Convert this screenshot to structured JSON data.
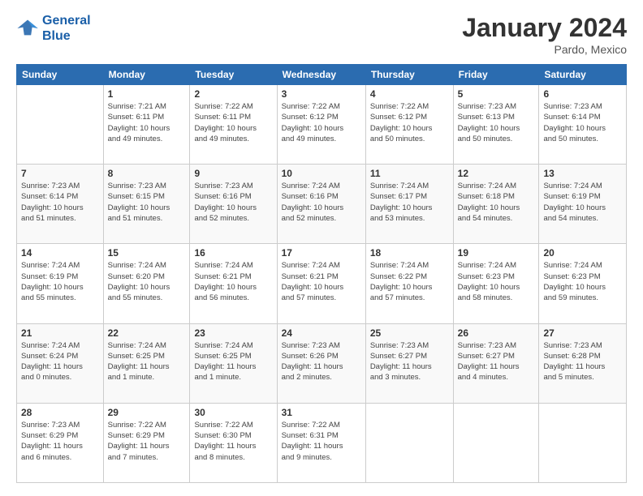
{
  "logo": {
    "line1": "General",
    "line2": "Blue"
  },
  "title": "January 2024",
  "location": "Pardo, Mexico",
  "days_of_week": [
    "Sunday",
    "Monday",
    "Tuesday",
    "Wednesday",
    "Thursday",
    "Friday",
    "Saturday"
  ],
  "weeks": [
    [
      {
        "day": "",
        "info": ""
      },
      {
        "day": "1",
        "info": "Sunrise: 7:21 AM\nSunset: 6:11 PM\nDaylight: 10 hours\nand 49 minutes."
      },
      {
        "day": "2",
        "info": "Sunrise: 7:22 AM\nSunset: 6:11 PM\nDaylight: 10 hours\nand 49 minutes."
      },
      {
        "day": "3",
        "info": "Sunrise: 7:22 AM\nSunset: 6:12 PM\nDaylight: 10 hours\nand 49 minutes."
      },
      {
        "day": "4",
        "info": "Sunrise: 7:22 AM\nSunset: 6:12 PM\nDaylight: 10 hours\nand 50 minutes."
      },
      {
        "day": "5",
        "info": "Sunrise: 7:23 AM\nSunset: 6:13 PM\nDaylight: 10 hours\nand 50 minutes."
      },
      {
        "day": "6",
        "info": "Sunrise: 7:23 AM\nSunset: 6:14 PM\nDaylight: 10 hours\nand 50 minutes."
      }
    ],
    [
      {
        "day": "7",
        "info": "Sunrise: 7:23 AM\nSunset: 6:14 PM\nDaylight: 10 hours\nand 51 minutes."
      },
      {
        "day": "8",
        "info": "Sunrise: 7:23 AM\nSunset: 6:15 PM\nDaylight: 10 hours\nand 51 minutes."
      },
      {
        "day": "9",
        "info": "Sunrise: 7:23 AM\nSunset: 6:16 PM\nDaylight: 10 hours\nand 52 minutes."
      },
      {
        "day": "10",
        "info": "Sunrise: 7:24 AM\nSunset: 6:16 PM\nDaylight: 10 hours\nand 52 minutes."
      },
      {
        "day": "11",
        "info": "Sunrise: 7:24 AM\nSunset: 6:17 PM\nDaylight: 10 hours\nand 53 minutes."
      },
      {
        "day": "12",
        "info": "Sunrise: 7:24 AM\nSunset: 6:18 PM\nDaylight: 10 hours\nand 54 minutes."
      },
      {
        "day": "13",
        "info": "Sunrise: 7:24 AM\nSunset: 6:19 PM\nDaylight: 10 hours\nand 54 minutes."
      }
    ],
    [
      {
        "day": "14",
        "info": "Sunrise: 7:24 AM\nSunset: 6:19 PM\nDaylight: 10 hours\nand 55 minutes."
      },
      {
        "day": "15",
        "info": "Sunrise: 7:24 AM\nSunset: 6:20 PM\nDaylight: 10 hours\nand 55 minutes."
      },
      {
        "day": "16",
        "info": "Sunrise: 7:24 AM\nSunset: 6:21 PM\nDaylight: 10 hours\nand 56 minutes."
      },
      {
        "day": "17",
        "info": "Sunrise: 7:24 AM\nSunset: 6:21 PM\nDaylight: 10 hours\nand 57 minutes."
      },
      {
        "day": "18",
        "info": "Sunrise: 7:24 AM\nSunset: 6:22 PM\nDaylight: 10 hours\nand 57 minutes."
      },
      {
        "day": "19",
        "info": "Sunrise: 7:24 AM\nSunset: 6:23 PM\nDaylight: 10 hours\nand 58 minutes."
      },
      {
        "day": "20",
        "info": "Sunrise: 7:24 AM\nSunset: 6:23 PM\nDaylight: 10 hours\nand 59 minutes."
      }
    ],
    [
      {
        "day": "21",
        "info": "Sunrise: 7:24 AM\nSunset: 6:24 PM\nDaylight: 11 hours\nand 0 minutes."
      },
      {
        "day": "22",
        "info": "Sunrise: 7:24 AM\nSunset: 6:25 PM\nDaylight: 11 hours\nand 1 minute."
      },
      {
        "day": "23",
        "info": "Sunrise: 7:24 AM\nSunset: 6:25 PM\nDaylight: 11 hours\nand 1 minute."
      },
      {
        "day": "24",
        "info": "Sunrise: 7:23 AM\nSunset: 6:26 PM\nDaylight: 11 hours\nand 2 minutes."
      },
      {
        "day": "25",
        "info": "Sunrise: 7:23 AM\nSunset: 6:27 PM\nDaylight: 11 hours\nand 3 minutes."
      },
      {
        "day": "26",
        "info": "Sunrise: 7:23 AM\nSunset: 6:27 PM\nDaylight: 11 hours\nand 4 minutes."
      },
      {
        "day": "27",
        "info": "Sunrise: 7:23 AM\nSunset: 6:28 PM\nDaylight: 11 hours\nand 5 minutes."
      }
    ],
    [
      {
        "day": "28",
        "info": "Sunrise: 7:23 AM\nSunset: 6:29 PM\nDaylight: 11 hours\nand 6 minutes."
      },
      {
        "day": "29",
        "info": "Sunrise: 7:22 AM\nSunset: 6:29 PM\nDaylight: 11 hours\nand 7 minutes."
      },
      {
        "day": "30",
        "info": "Sunrise: 7:22 AM\nSunset: 6:30 PM\nDaylight: 11 hours\nand 8 minutes."
      },
      {
        "day": "31",
        "info": "Sunrise: 7:22 AM\nSunset: 6:31 PM\nDaylight: 11 hours\nand 9 minutes."
      },
      {
        "day": "",
        "info": ""
      },
      {
        "day": "",
        "info": ""
      },
      {
        "day": "",
        "info": ""
      }
    ]
  ]
}
